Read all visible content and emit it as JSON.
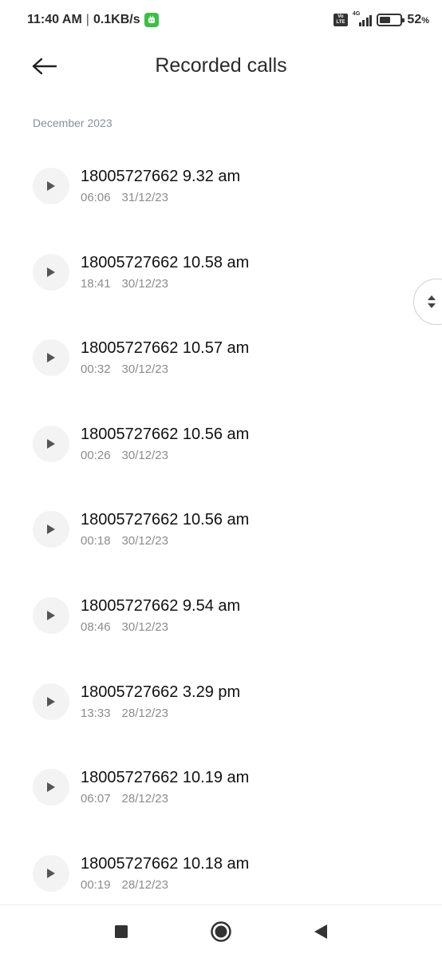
{
  "status_bar": {
    "time": "11:40 AM",
    "separator": "|",
    "net_speed": "0.1KB/s",
    "volte_line1": "Vo",
    "volte_line2": "LTE",
    "network_type": "4G",
    "battery_level": 52,
    "battery_text": "52",
    "battery_unit": "%"
  },
  "header": {
    "title": "Recorded calls"
  },
  "section": {
    "label": "December 2023"
  },
  "recordings": [
    {
      "title": "18005727662 9.32 am",
      "duration": "06:06",
      "date": "31/12/23"
    },
    {
      "title": "18005727662 10.58 am",
      "duration": "18:41",
      "date": "30/12/23"
    },
    {
      "title": "18005727662 10.57 am",
      "duration": "00:32",
      "date": "30/12/23"
    },
    {
      "title": "18005727662 10.56 am",
      "duration": "00:26",
      "date": "30/12/23"
    },
    {
      "title": "18005727662 10.56 am",
      "duration": "00:18",
      "date": "30/12/23"
    },
    {
      "title": "18005727662 9.54 am",
      "duration": "08:46",
      "date": "30/12/23"
    },
    {
      "title": "18005727662 3.29 pm",
      "duration": "13:33",
      "date": "28/12/23"
    },
    {
      "title": "18005727662 10.19 am",
      "duration": "06:07",
      "date": "28/12/23"
    },
    {
      "title": "18005727662 10.18 am",
      "duration": "00:19",
      "date": "28/12/23"
    }
  ],
  "icons": {
    "back": "arrow-left-icon",
    "play": "play-icon",
    "scroll": "up-down-chevron-icon",
    "nav_recents": "square-icon",
    "nav_home": "circle-icon",
    "nav_back": "triangle-back-icon"
  },
  "colors": {
    "accent_notification": "#3ac043",
    "play_bg": "#f3f3f3",
    "secondary_text": "#8c8c8c",
    "section_text": "#8a8f99"
  }
}
